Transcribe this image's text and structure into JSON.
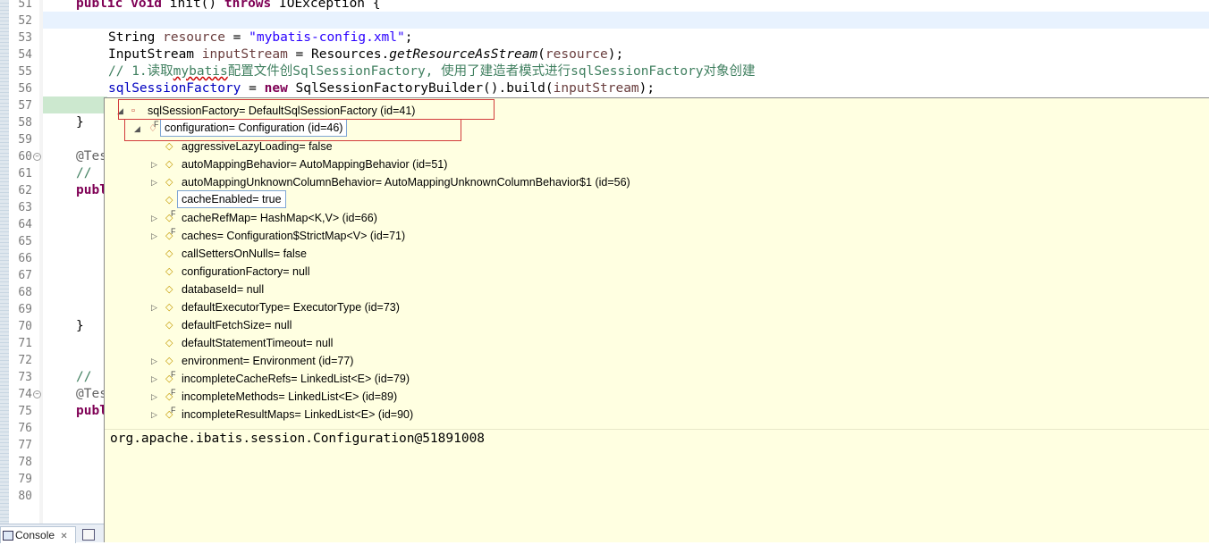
{
  "editor": {
    "line_numbers": [
      "51",
      "52",
      "53",
      "54",
      "55",
      "56",
      "57",
      "58",
      "59",
      "60",
      "61",
      "62",
      "63",
      "64",
      "65",
      "66",
      "67",
      "68",
      "69",
      "70",
      "71",
      "72",
      "73",
      "74",
      "75",
      "76",
      "77",
      "78",
      "79",
      "80"
    ],
    "code": {
      "l51_kw1": "public void",
      "l51_mid": " init() ",
      "l51_kw2": "throws",
      "l51_end": " IOException {",
      "l53_type": "String ",
      "l53_var": "resource",
      "l53_eq": " = ",
      "l53_str": "\"mybatis-config.xml\"",
      "l53_end": ";",
      "l54_type": "InputStream ",
      "l54_var": "inputStream",
      "l54_eq": " = Resources.",
      "l54_mth": "getResourceAsStream",
      "l54_open": "(",
      "l54_arg": "resource",
      "l54_end": ");",
      "l55_cmt_a": "// 1.读取",
      "l55_cmt_und": "mybatis",
      "l55_cmt_b": "配置文件创SqlSessionFactory, 使用了建造者模式进行sqlSessionFactory对象创建",
      "l56_fld": "sqlSessionFactory",
      "l56_eq": " = ",
      "l56_kw": "new",
      "l56_mid": " SqlSessionFactoryBuilder().build(",
      "l56_arg": "inputStream",
      "l56_end": ");",
      "l58": "}",
      "l60": "@Tes",
      "l61": "// ",
      "l62": "publ",
      "l70": "}",
      "l73": "// ",
      "l74": "@Tes",
      "l75": "publ"
    }
  },
  "hover": {
    "tree": [
      {
        "label": "sqlSessionFactory= DefaultSqlSessionFactory  (id=41)",
        "expanded": true,
        "icon": "red-field-icon"
      },
      {
        "label": "configuration= Configuration  (id=46)",
        "expanded": true,
        "icon": "final-field-icon",
        "selected": true
      },
      {
        "label": "aggressiveLazyLoading= false",
        "expanded": null,
        "icon": "field-icon"
      },
      {
        "label": "autoMappingBehavior= AutoMappingBehavior  (id=51)",
        "expanded": false,
        "icon": "field-icon"
      },
      {
        "label": "autoMappingUnknownColumnBehavior= AutoMappingUnknownColumnBehavior$1  (id=56)",
        "expanded": false,
        "icon": "field-icon"
      },
      {
        "label": "cacheEnabled= true",
        "expanded": null,
        "icon": "field-icon",
        "boxed": true
      },
      {
        "label": "cacheRefMap= HashMap<K,V>  (id=66)",
        "expanded": false,
        "icon": "final-field-icon"
      },
      {
        "label": "caches= Configuration$StrictMap<V>  (id=71)",
        "expanded": false,
        "icon": "final-field-icon"
      },
      {
        "label": "callSettersOnNulls= false",
        "expanded": null,
        "icon": "field-icon"
      },
      {
        "label": "configurationFactory= null",
        "expanded": null,
        "icon": "field-icon"
      },
      {
        "label": "databaseId= null",
        "expanded": null,
        "icon": "field-icon"
      },
      {
        "label": "defaultExecutorType= ExecutorType  (id=73)",
        "expanded": false,
        "icon": "field-icon"
      },
      {
        "label": "defaultFetchSize= null",
        "expanded": null,
        "icon": "field-icon"
      },
      {
        "label": "defaultStatementTimeout= null",
        "expanded": null,
        "icon": "field-icon"
      },
      {
        "label": "environment= Environment  (id=77)",
        "expanded": false,
        "icon": "field-icon"
      },
      {
        "label": "incompleteCacheRefs= LinkedList<E>  (id=79)",
        "expanded": false,
        "icon": "final-field-icon"
      },
      {
        "label": "incompleteMethods= LinkedList<E>  (id=89)",
        "expanded": false,
        "icon": "final-field-icon"
      },
      {
        "label": "incompleteResultMaps= LinkedList<E>  (id=90)",
        "expanded": false,
        "icon": "final-field-icon"
      }
    ],
    "detail": "org.apache.ibatis.session.Configuration@51891008"
  },
  "bottom": {
    "console_tab": "Console"
  }
}
